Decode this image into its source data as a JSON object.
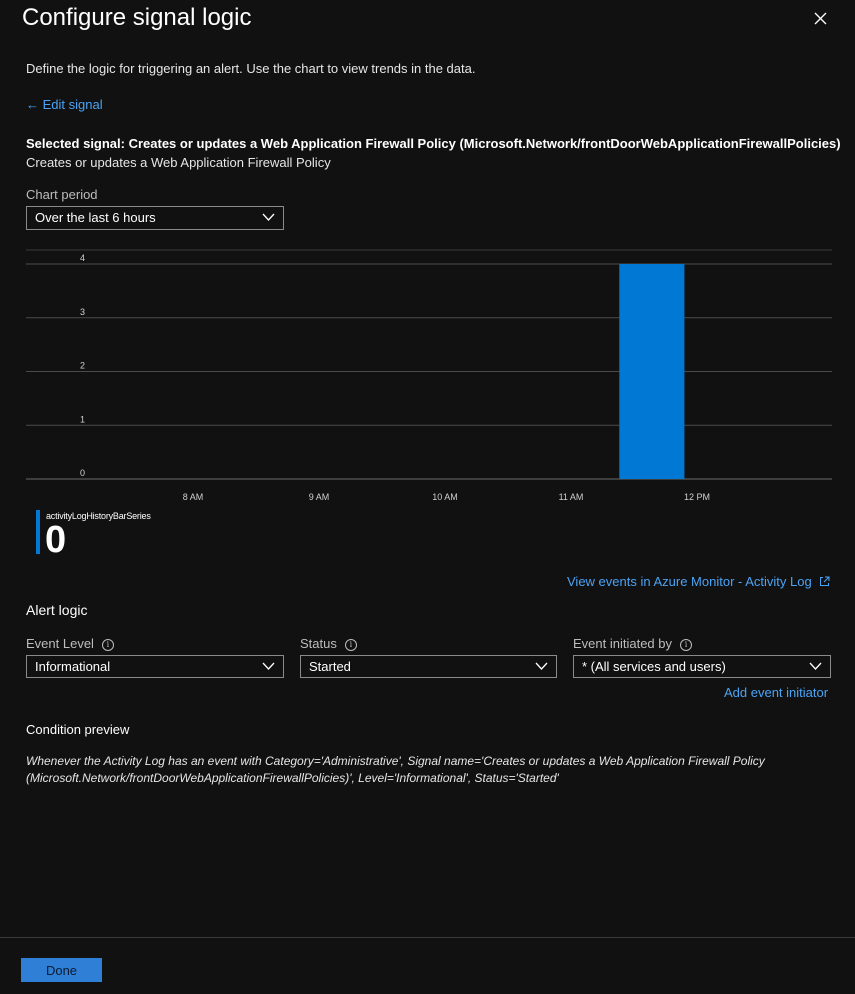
{
  "header": {
    "title": "Configure signal logic",
    "close_icon": "close-icon"
  },
  "description": "Define the logic for triggering an alert. Use the chart to view trends in the data.",
  "edit_signal": {
    "arrow": "←",
    "label": "Edit signal"
  },
  "selected_signal": {
    "title": "Selected signal: Creates or updates a Web Application Firewall Policy (Microsoft.Network/frontDoorWebApplicationFirewallPolicies)",
    "subtitle": "Creates or updates a Web Application Firewall Policy"
  },
  "chart_period": {
    "label": "Chart period",
    "value": "Over the last 6 hours"
  },
  "chart_data": {
    "type": "bar",
    "series": [
      {
        "name": "activityLogHistoryBarSeries",
        "color": "#0078d4",
        "bars": [
          {
            "start": "11:23",
            "end": "11:54",
            "value": 4
          }
        ]
      }
    ],
    "x_ticks": [
      "8 AM",
      "9 AM",
      "10 AM",
      "11 AM",
      "12 PM"
    ],
    "y_ticks": [
      "0",
      "1",
      "2",
      "3",
      "4"
    ],
    "ylim": [
      0,
      4
    ],
    "grid": true
  },
  "legend": {
    "series_name": "activityLogHistoryBarSeries",
    "value": "0"
  },
  "monitor_link": {
    "label": "View events in Azure Monitor - Activity Log",
    "icon": "external-link-icon"
  },
  "alert_logic": {
    "title": "Alert logic",
    "event_level": {
      "label": "Event Level",
      "value": "Informational"
    },
    "status": {
      "label": "Status",
      "value": "Started"
    },
    "event_initiated_by": {
      "label": "Event initiated by",
      "value": "* (All services and users)"
    },
    "add_initiator": "Add event initiator"
  },
  "condition_preview": {
    "title": "Condition preview",
    "text": "Whenever the Activity Log has an event with Category='Administrative', Signal name='Creates or updates a Web Application Firewall Policy (Microsoft.Network/frontDoorWebApplicationFirewallPolicies)', Level='Informational', Status='Started'"
  },
  "footer": {
    "done_label": "Done"
  },
  "colors": {
    "background": "#111111",
    "link": "#4aa3f5",
    "bar": "#0078d4",
    "button": "#2f7fd6"
  }
}
